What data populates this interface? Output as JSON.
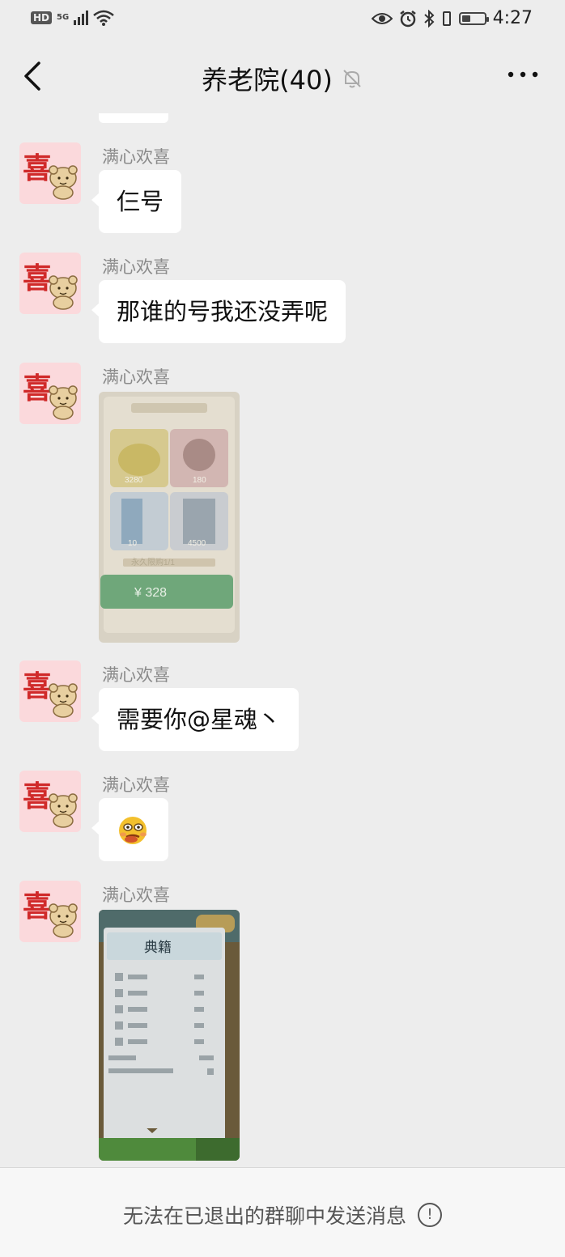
{
  "status_bar": {
    "hd": "HD",
    "network": "5G",
    "time": "4:27",
    "battery_level": 0.4
  },
  "header": {
    "title": "养老院(40)"
  },
  "sender_name": "满心欢喜",
  "messages": [
    {
      "type": "text",
      "sender": "满心欢喜",
      "text": "仨号"
    },
    {
      "type": "text",
      "sender": "满心欢喜",
      "text": "那谁的号我还没弄呢"
    },
    {
      "type": "image",
      "sender": "满心欢喜",
      "image": {
        "price": "¥ 328",
        "limit": "永久限购1/1",
        "items": [
          "3280",
          "180",
          "10",
          "4500"
        ]
      }
    },
    {
      "type": "text",
      "sender": "满心欢喜",
      "text": "需要你@星魂丶"
    },
    {
      "type": "emoji",
      "sender": "满心欢喜",
      "emoji": "🥴"
    },
    {
      "type": "image",
      "sender": "满心欢喜",
      "image": {
        "heading": "典籍"
      }
    }
  ],
  "footer": {
    "notice": "无法在已退出的群聊中发送消息"
  },
  "colors": {
    "background": "#ededed",
    "bubble": "#ffffff",
    "avatar_bg": "#fbd9dc",
    "avatar_glyph": "#d02a2a"
  }
}
